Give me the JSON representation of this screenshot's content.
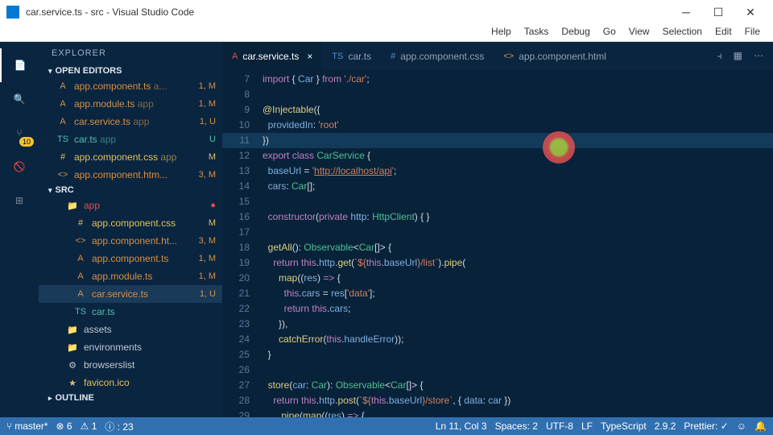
{
  "window": {
    "title": "car.service.ts - src - Visual Studio Code"
  },
  "menu": [
    "Help",
    "Tasks",
    "Debug",
    "Go",
    "View",
    "Selection",
    "Edit",
    "File"
  ],
  "activity": {
    "badge": "10"
  },
  "explorer": {
    "title": "EXPLORER",
    "openEditors": "OPEN EDITORS",
    "src": "SRC",
    "outline": "OUTLINE",
    "editors": [
      {
        "icon": "A",
        "name": "app.component.ts",
        "grp": "a...",
        "status": "1, M",
        "color": "c-orange"
      },
      {
        "icon": "A",
        "name": "app.module.ts",
        "grp": "app",
        "status": "1, M",
        "color": "c-orange"
      },
      {
        "icon": "A",
        "name": "car.service.ts",
        "grp": "app",
        "status": "1, U",
        "color": "c-orange"
      },
      {
        "icon": "TS",
        "name": "car.ts",
        "grp": "app",
        "status": "U",
        "color": "c-teal"
      },
      {
        "icon": "#",
        "name": "app.component.css",
        "grp": "app",
        "status": "M",
        "color": "c-yellow"
      },
      {
        "icon": "<>",
        "name": "app.component.htm...",
        "grp": "",
        "status": "3, M",
        "color": "c-orange"
      }
    ],
    "tree": [
      {
        "icon": "📁",
        "name": "app",
        "status": "●",
        "lvl": "sub",
        "color": "c-red"
      },
      {
        "icon": "#",
        "name": "app.component.css",
        "status": "M",
        "lvl": "sub2",
        "color": "c-yellow"
      },
      {
        "icon": "<>",
        "name": "app.component.ht...",
        "status": "3, M",
        "lvl": "sub2",
        "color": "c-orange"
      },
      {
        "icon": "A",
        "name": "app.component.ts",
        "status": "1, M",
        "lvl": "sub2",
        "color": "c-orange"
      },
      {
        "icon": "A",
        "name": "app.module.ts",
        "status": "1, M",
        "lvl": "sub2",
        "color": "c-orange"
      },
      {
        "icon": "A",
        "name": "car.service.ts",
        "status": "1, U",
        "lvl": "sub2",
        "color": "c-orange",
        "sel": true
      },
      {
        "icon": "TS",
        "name": "car.ts",
        "status": "",
        "lvl": "sub2",
        "color": "c-teal"
      },
      {
        "icon": "📁",
        "name": "assets",
        "status": "",
        "lvl": "sub",
        "color": ""
      },
      {
        "icon": "📁",
        "name": "environments",
        "status": "",
        "lvl": "sub",
        "color": ""
      },
      {
        "icon": "⚙",
        "name": "browserslist",
        "status": "",
        "lvl": "sub",
        "color": ""
      },
      {
        "icon": "★",
        "name": "favicon.ico",
        "status": "",
        "lvl": "sub",
        "color": "c-yellow"
      }
    ]
  },
  "tabs": [
    {
      "icon": "A",
      "name": "car.service.ts",
      "active": true,
      "ic": "c-red"
    },
    {
      "icon": "TS",
      "name": "car.ts",
      "active": false,
      "ic": "c-blue"
    },
    {
      "icon": "#",
      "name": "app.component.css",
      "active": false,
      "ic": "c-blue"
    },
    {
      "icon": "<>",
      "name": "app.component.html",
      "active": false,
      "ic": "c-orange"
    }
  ],
  "code": {
    "start": 7,
    "lines": [
      {
        "n": 7,
        "h": "<span class='kw'>import</span> { <span class='prop'>Car</span> } <span class='kw'>from</span> <span class='str'>'./car'</span>;"
      },
      {
        "n": 8,
        "h": ""
      },
      {
        "n": 9,
        "h": "<span class='fn'>@Injectable</span>({"
      },
      {
        "n": 10,
        "h": "  <span class='prop'>providedIn</span>: <span class='str'>'root'</span>"
      },
      {
        "n": 11,
        "h": "})",
        "hl": true
      },
      {
        "n": 12,
        "h": "<span class='kw'>export</span> <span class='kw'>class</span> <span class='cls'>CarService</span> {"
      },
      {
        "n": 13,
        "h": "  <span class='prop'>baseUrl</span> = <span class='str'>'</span><span class='link'>http://localhost/api</span><span class='str'>'</span>;"
      },
      {
        "n": 14,
        "h": "  <span class='prop'>cars</span>: <span class='cls'>Car</span>[];"
      },
      {
        "n": 15,
        "h": ""
      },
      {
        "n": 16,
        "h": "  <span class='kw'>constructor</span>(<span class='kw'>private</span> <span class='prop'>http</span>: <span class='cls'>HttpClient</span>) { }"
      },
      {
        "n": 17,
        "h": ""
      },
      {
        "n": 18,
        "h": "  <span class='fn'>getAll</span>(): <span class='cls'>Observable</span>&lt;<span class='cls'>Car</span>[]&gt; {"
      },
      {
        "n": 19,
        "h": "    <span class='kw'>return</span> <span class='kw'>this</span>.<span class='prop'>http</span>.<span class='fn'>get</span>(<span class='str'>`${</span><span class='kw'>this</span>.<span class='prop'>baseUrl</span><span class='str'>}/list`</span>).<span class='fn'>pipe</span>("
      },
      {
        "n": 20,
        "h": "      <span class='fn'>map</span>((<span class='prop'>res</span>) <span class='kw'>=&gt;</span> {"
      },
      {
        "n": 21,
        "h": "        <span class='kw'>this</span>.<span class='prop'>cars</span> = <span class='prop'>res</span>[<span class='str'>'data'</span>];"
      },
      {
        "n": 22,
        "h": "        <span class='kw'>return</span> <span class='kw'>this</span>.<span class='prop'>cars</span>;"
      },
      {
        "n": 23,
        "h": "      }),"
      },
      {
        "n": 24,
        "h": "      <span class='fn'>catchError</span>(<span class='kw'>this</span>.<span class='prop'>handleError</span>));"
      },
      {
        "n": 25,
        "h": "  }"
      },
      {
        "n": 26,
        "h": ""
      },
      {
        "n": 27,
        "h": "  <span class='fn'>store</span>(<span class='prop'>car</span>: <span class='cls'>Car</span>): <span class='cls'>Observable</span>&lt;<span class='cls'>Car</span>[]&gt; {"
      },
      {
        "n": 28,
        "h": "    <span class='kw'>return</span> <span class='kw'>this</span>.<span class='prop'>http</span>.<span class='fn'>post</span>(<span class='str'>`${</span><span class='kw'>this</span>.<span class='prop'>baseUrl</span><span class='str'>}/store`</span>, { <span class='prop'>data</span>: <span class='prop'>car</span> })"
      },
      {
        "n": 29,
        "h": "      .<span class='fn'>pipe</span>(<span class='fn'>map</span>((<span class='prop'>res</span>) <span class='kw'>=&gt;</span> {"
      }
    ]
  },
  "status": {
    "branch": "master*",
    "errors": "⊗ 6",
    "warnings": "⚠ 1",
    "info": "ⓘ : 23",
    "pos": "Ln 11, Col 3",
    "spaces": "Spaces: 2",
    "enc": "UTF-8",
    "eol": "LF",
    "lang": "TypeScript",
    "ver": "2.9.2",
    "prettier": "Prettier: ✓",
    "smile": "☺",
    "bell": "🔔"
  }
}
